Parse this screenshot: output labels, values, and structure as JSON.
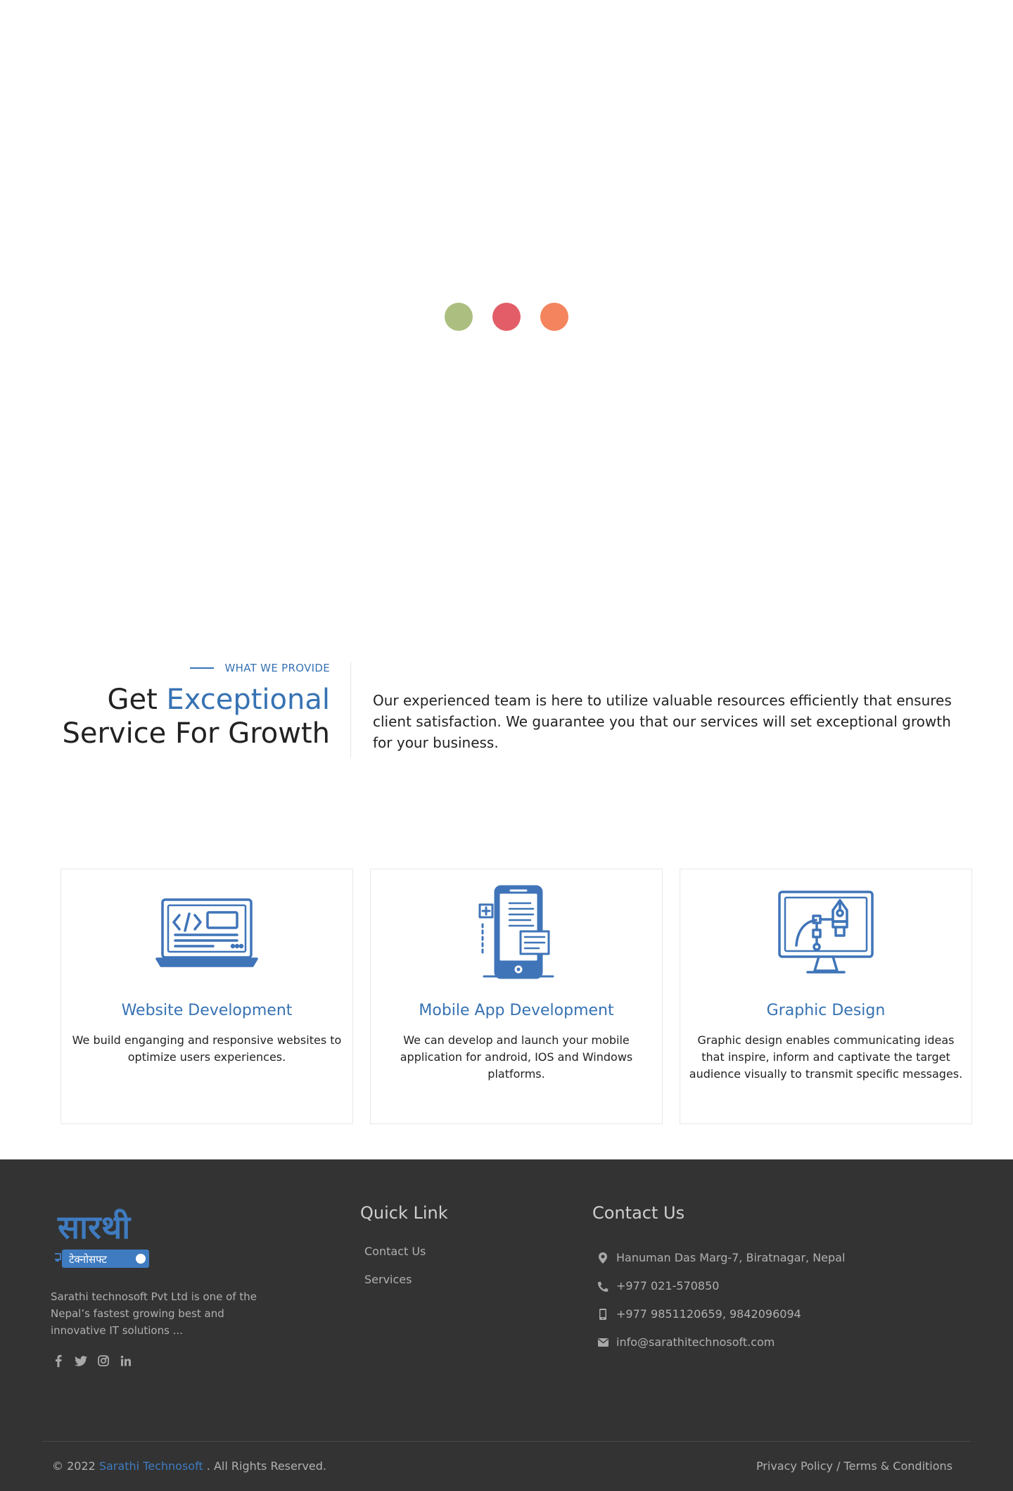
{
  "loader": {
    "dots": [
      {
        "color": "#adbf80"
      },
      {
        "color": "#e25d67"
      },
      {
        "color": "#f4845e"
      }
    ]
  },
  "intro": {
    "eyebrow": "WHAT WE PROVIDE",
    "heading_prefix": "Get ",
    "heading_accent": "Exceptional",
    "heading_line2": "Service For Growth",
    "text": "Our experienced team is here to utilize valuable resources efficiently that ensures client satisfaction. We guarantee you that our services will set exceptional growth for your business."
  },
  "services": [
    {
      "icon": "laptop-code-icon",
      "title": "Website Development",
      "desc": "We build enganging and responsive websites to optimize users experiences."
    },
    {
      "icon": "mobile-app-icon",
      "title": "Mobile App Development",
      "desc": "We can develop and launch your mobile application for android, IOS and Windows platforms."
    },
    {
      "icon": "graphic-design-icon",
      "title": "Graphic Design",
      "desc": "Graphic design enables communicating ideas that inspire, inform and captivate the target audience visually to transmit specific messages."
    }
  ],
  "footer": {
    "logo_text_top": "सारथी",
    "logo_text_bottom": "टेक्नोसफ्ट",
    "about": "Sarathi technosoft Pvt Ltd is one of the Nepal’s fastest growing best and innovative IT solutions ...",
    "social": [
      "facebook-icon",
      "twitter-icon",
      "instagram-icon",
      "linkedin-icon"
    ],
    "quick_link": {
      "heading": "Quick Link",
      "items": [
        "Contact Us",
        "Services"
      ]
    },
    "contact": {
      "heading": "Contact Us",
      "address": "Hanuman Das Marg-7, Biratnagar, Nepal",
      "phone": "+977 021-570850",
      "mobile": "+977 9851120659, 9842096094",
      "email": "info@sarathitechnosoft.com"
    },
    "copyright_prefix": "© 2022 ",
    "copyright_brand": "Sarathi Technosoft",
    "copyright_suffix": " . All Rights Reserved.",
    "legal": "Privacy Policy / Terms & Conditions"
  },
  "colors": {
    "accent": "#3672b3",
    "footer_bg": "#333333"
  }
}
